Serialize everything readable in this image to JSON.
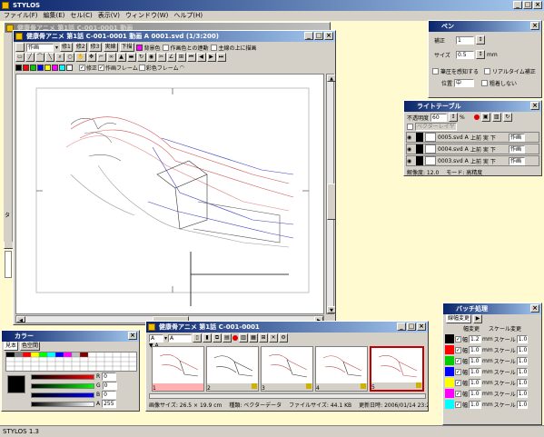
{
  "app": {
    "title": "STYLOS",
    "status": "STYLOS 1.3"
  },
  "menu": [
    "ファイル(F)",
    "編集(E)",
    "セル(C)",
    "表示(V)",
    "ウィンドウ(W)",
    "ヘルプ(H)"
  ],
  "behind_window": {
    "title": "健康骨アニメ 第1話 C-001-0001 動画"
  },
  "canvas_window": {
    "title": "健康骨アニメ 第1話 C-001-0001 動画 A 0001.svd (1/3:200)",
    "layer_select": "作画",
    "pen_labels": [
      "修1",
      "修2",
      "修3",
      "実線",
      "下描"
    ],
    "background_color_label": "背景色",
    "linked_label": "作画色との連動",
    "main_draw_label": "主線の上に描画",
    "correction_label": "修正",
    "frame_label": "作画フレーム",
    "color_frame_label": "彩色フレーム",
    "left_tab": "タ"
  },
  "pen_panel": {
    "title": "ペン",
    "correction_label": "補正",
    "correction_value": "1",
    "size_label": "サイズ",
    "size_value": "0.5",
    "size_unit": "mm",
    "pressure_label": "筆圧を感知する",
    "realtime_label": "リアルタイム補正",
    "position_label": "位置",
    "position_value": "中",
    "no_slip_label": "粗着しない"
  },
  "lighttable": {
    "title": "ライトテーブル",
    "opacity_label": "不透明度",
    "opacity_value": "60",
    "percent": "%",
    "vector_layer_label": "ベクターレイヤ",
    "rows": [
      {
        "name": "0005.svd A...",
        "opts": "上前 実 下",
        "mode": "作画"
      },
      {
        "name": "0004.svd A...",
        "opts": "上前 実 下",
        "mode": "作画"
      },
      {
        "name": "0003.svd A...",
        "opts": "上前 実 下",
        "mode": "作画"
      }
    ],
    "resolution": "解像度: 12.0",
    "mode_status": "モード: 高精度"
  },
  "color_panel": {
    "title": "カラー",
    "tabs": [
      "見本",
      "色空間"
    ],
    "sliders": [
      {
        "label": "R",
        "value": "0"
      },
      {
        "label": "G",
        "value": "0"
      },
      {
        "label": "B",
        "value": "0"
      },
      {
        "label": "A",
        "value": "255"
      }
    ],
    "colors": {
      "current": "#000000"
    }
  },
  "cel_list": {
    "title": "健康骨アニメ 第1話 C-001-0001",
    "cel_select": "A",
    "layer_select": "A",
    "frames": [
      "1",
      "2",
      "3",
      "4",
      "5"
    ],
    "selected_frame_index": 4,
    "info": {
      "image_size": "画像サイズ: 26.5 × 19.9 cm",
      "type": "種類: ベクターデータ",
      "file_size": "ファイルサイズ: 44.1 KB",
      "modified": "更新日時: 2006/01/14 23:27"
    }
  },
  "batch_panel": {
    "title": "バッチ処理",
    "tab": "線幅変更",
    "col_width": "幅変更",
    "col_scale": "スケール変更",
    "rows": [
      {
        "color": "#000000",
        "width": "1.2",
        "unit": "mm",
        "scale_label": "スケール",
        "scale": "1.0"
      },
      {
        "color": "#ff0000",
        "width": "1.0",
        "unit": "mm",
        "scale_label": "スケール",
        "scale": "1.0"
      },
      {
        "color": "#00cc00",
        "width": "1.0",
        "unit": "mm",
        "scale_label": "スケール",
        "scale": "1.0"
      },
      {
        "color": "#0000ff",
        "width": "1.0",
        "unit": "mm",
        "scale_label": "スケール",
        "scale": "1.0"
      },
      {
        "color": "#ffff00",
        "width": "1.0",
        "unit": "mm",
        "scale_label": "スケール",
        "scale": "1.0"
      },
      {
        "color": "#ff00ff",
        "width": "1.0",
        "unit": "mm",
        "scale_label": "スケール",
        "scale": "1.0"
      },
      {
        "color": "#00ffff",
        "width": "1.0",
        "unit": "mm",
        "scale_label": "スケール",
        "scale": "1.0"
      }
    ]
  }
}
